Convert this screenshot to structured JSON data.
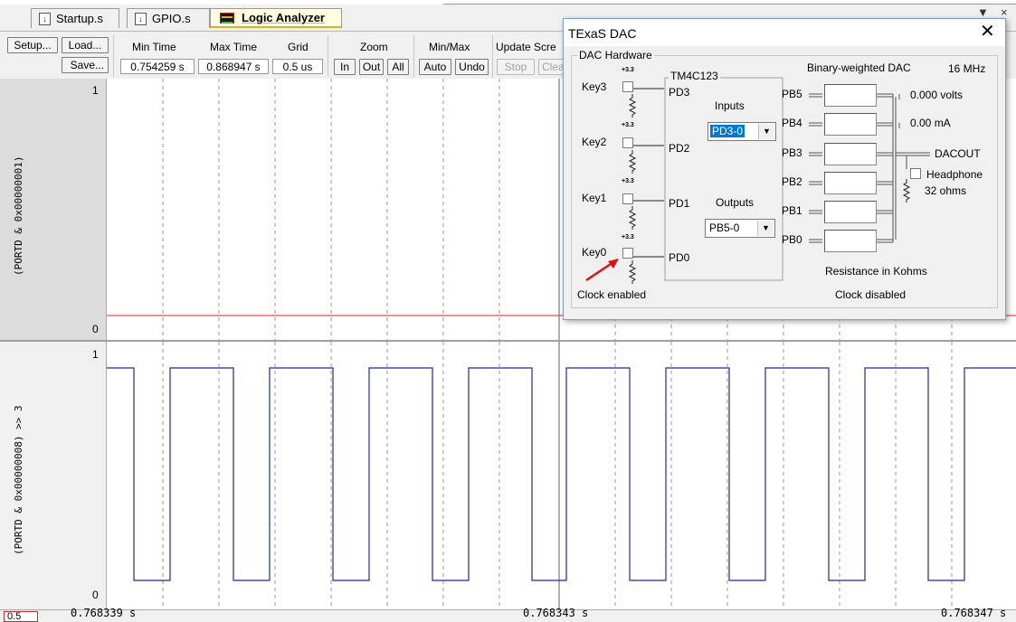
{
  "tabs": [
    {
      "label": "Startup.s",
      "icon": "asm-file-icon",
      "active": false
    },
    {
      "label": "GPIO.s",
      "icon": "asm-file-icon",
      "active": false
    },
    {
      "label": "Logic Analyzer",
      "icon": "logic-analyzer-icon",
      "active": true
    }
  ],
  "window_controls": {
    "pin": "▼",
    "close": "×"
  },
  "toolbar": {
    "setup": "Setup...",
    "load": "Load...",
    "save": "Save...",
    "min_time_label": "Min Time",
    "min_time_value": "0.754259 s",
    "max_time_label": "Max Time",
    "max_time_value": "0.868947 s",
    "grid_label": "Grid",
    "grid_value": "0.5 us",
    "zoom_label": "Zoom",
    "zoom_in": "In",
    "zoom_out": "Out",
    "zoom_all": "All",
    "minmax_label": "Min/Max",
    "auto": "Auto",
    "undo": "Undo",
    "update_label": "Update Scre",
    "stop": "Stop",
    "clear": "Clea"
  },
  "signals": [
    {
      "expr": "(PORTD & 0x00000001)",
      "max": "1",
      "min": "0",
      "value": 0
    },
    {
      "expr": "(PORTD & 0x00000008) >> 3",
      "max": "1",
      "min": "0"
    }
  ],
  "colors": {
    "signal1_line": "#e02020",
    "signal2_line": "#1a2aa0",
    "grid": "#808080",
    "cursor": "#606060"
  },
  "time_axis": {
    "zoom_box": "0.5",
    "labels": [
      "0.768339 s",
      "0.768343 s",
      "0.768347 s"
    ]
  },
  "dac": {
    "title": "TExaS DAC",
    "group": "DAC Hardware",
    "supply": "+3.3",
    "keys": [
      "Key3",
      "Key2",
      "Key1",
      "Key0"
    ],
    "mcu": "TM4C123",
    "pd_pins": [
      "PD3",
      "PD2",
      "PD1",
      "PD0"
    ],
    "inputs_label": "Inputs",
    "inputs_value": "PD3-0",
    "outputs_label": "Outputs",
    "outputs_value": "PB5-0",
    "pb_pins": [
      "PB5",
      "PB4",
      "PB3",
      "PB2",
      "PB1",
      "PB0"
    ],
    "dac_type": "Binary-weighted DAC",
    "clock": "16 MHz",
    "volts": "0.000 volts",
    "current": "0.00 mA",
    "dacout": "DACOUT",
    "headphone": "Headphone",
    "ohms": "32 ohms",
    "resistance_label": "Resistance in Kohms",
    "clock_enabled": "Clock enabled",
    "clock_disabled": "Clock disabled"
  }
}
